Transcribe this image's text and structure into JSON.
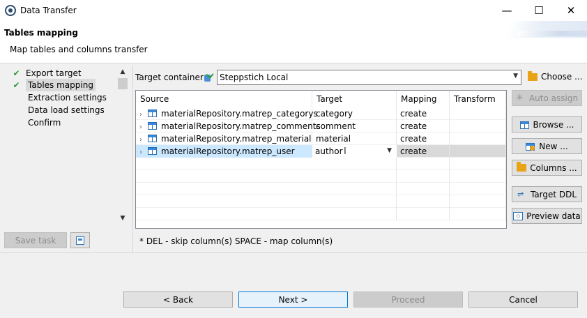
{
  "window": {
    "title": "Data Transfer",
    "controls": {
      "minimize": "—",
      "maximize": "☐",
      "close": "✕"
    }
  },
  "header": {
    "title": "Tables mapping",
    "subtitle": "Map tables and columns transfer"
  },
  "nav": {
    "items": [
      {
        "label": "Export target",
        "checked": true
      },
      {
        "label": "Tables mapping",
        "checked": true,
        "selected": true
      },
      {
        "label": "Extraction settings",
        "checked": false
      },
      {
        "label": "Data load settings",
        "checked": false
      },
      {
        "label": "Confirm",
        "checked": false
      }
    ]
  },
  "task": {
    "save_label": "Save task"
  },
  "container": {
    "label": "Target container:",
    "value": "Steppstich Local",
    "choose_label": "Choose ..."
  },
  "grid": {
    "columns": [
      "Source",
      "Target",
      "Mapping",
      "Transform"
    ],
    "rows": [
      {
        "source": "materialRepository.matrep_categorys",
        "target": "category",
        "mapping": "create",
        "transform": ""
      },
      {
        "source": "materialRepository.matrep_comments",
        "target": "comment",
        "mapping": "create",
        "transform": ""
      },
      {
        "source": "materialRepository.matrep_material",
        "target": "material",
        "mapping": "create",
        "transform": ""
      },
      {
        "source": "materialRepository.matrep_user",
        "target": "author",
        "mapping": "create",
        "transform": "",
        "editing": true
      }
    ]
  },
  "actions": {
    "auto_assign": "Auto assign",
    "browse": "Browse ...",
    "new": "New ...",
    "columns": "Columns ...",
    "target_ddl": "Target DDL",
    "preview": "Preview data"
  },
  "hint": "* DEL - skip column(s)  SPACE - map column(s)",
  "footer": {
    "back": "< Back",
    "next": "Next >",
    "proceed": "Proceed",
    "cancel": "Cancel"
  },
  "colors": {
    "selected_row": "#cce8ff",
    "check": "#2e9c3a",
    "folder": "#e8a317"
  }
}
